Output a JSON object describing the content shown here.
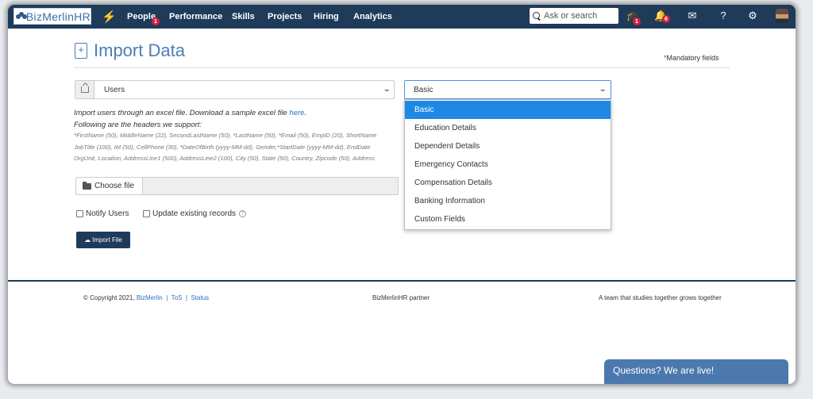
{
  "nav": {
    "logo": "BizMerlinHR",
    "items": [
      {
        "label": "People",
        "badge": "1"
      },
      {
        "label": "Performance"
      },
      {
        "label": "Skills"
      },
      {
        "label": "Projects"
      },
      {
        "label": "Hiring"
      },
      {
        "label": "Analytics"
      }
    ],
    "search_placeholder": "Ask or search",
    "learning_badge": "1",
    "notification_badge": "6"
  },
  "page": {
    "title": "Import Data",
    "mandatory_label": "Mandatory fields"
  },
  "form": {
    "entity_select": "Users",
    "type_select": "Basic",
    "help_text": "Import users through an excel file. Download a sample excel file ",
    "help_link": "here",
    "help_period": ".",
    "headers_intro": "Following are the headers we support:",
    "headers_line1_a": "FirstName (50), MiddleName (22), SecondLastName (50), ",
    "headers_line1_b": "LastName (50), ",
    "headers_line1_c": "Email (50), EmpID (20), ShortName",
    "headers_line2_a": "JobTitle (100), IM (50), CellPhone (30), ",
    "headers_line2_b": "DateOfBirth (yyyy-MM-dd), Gender,",
    "headers_line2_c": "StartDate (yyyy-MM-dd), EndDate",
    "headers_line3": "OrgUnit, Location, AddressLine1 (500), AddressLine2 (100), City (50), State (50), Country, Zipcode (50), Address",
    "choose_file_label": "Choose file",
    "notify_users_label": "Notify Users",
    "update_existing_label": "Update existing records",
    "import_button_label": "Import File"
  },
  "dropdown": {
    "options": [
      "Basic",
      "Education Details",
      "Dependent Details",
      "Emergency Contacts",
      "Compensation Details",
      "Banking Information",
      "Custom Fields"
    ],
    "selected_index": 0
  },
  "footer": {
    "copyright": "© Copyright 2021, ",
    "company_link": "BizMerlin",
    "sep": "|",
    "tos_link": "ToS",
    "status_link": "Status",
    "partner": "BizMerlinHR partner",
    "tagline": "A team that studies together grows together"
  },
  "chat": {
    "label": "Questions? We are live!"
  },
  "colors": {
    "nav_bg": "#1f3b5a",
    "accent": "#4a7fb5",
    "selected": "#1e88e5",
    "badge": "#d4213d",
    "chat": "#4b79ad"
  }
}
